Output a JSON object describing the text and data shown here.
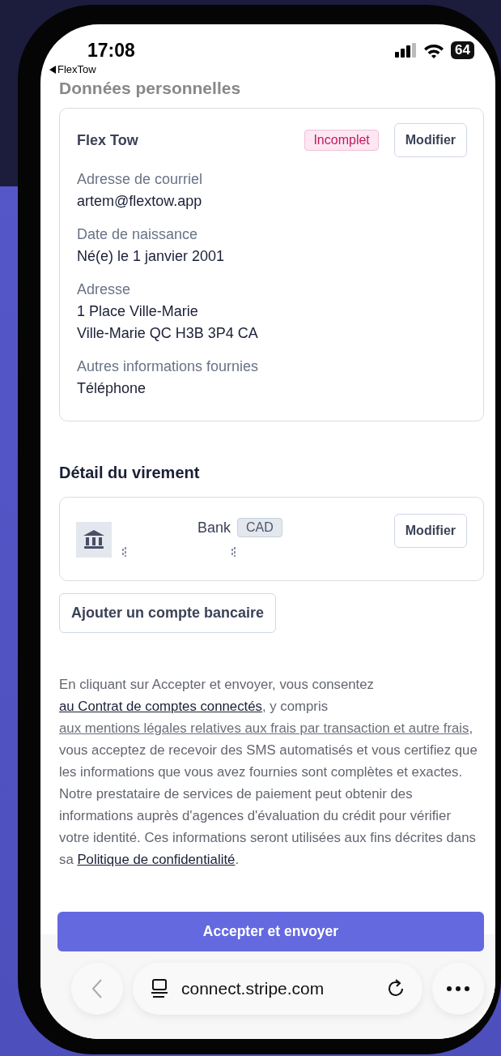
{
  "status_bar": {
    "time": "17:08",
    "battery": "64"
  },
  "back_link": {
    "label": "FlexTow"
  },
  "section_title": "Données personnelles",
  "profile": {
    "name": "Flex Tow",
    "badge": "Incomplet",
    "edit_button": "Modifier",
    "fields": [
      {
        "label": "Adresse de courriel",
        "lines": [
          "artem@flextow.app"
        ]
      },
      {
        "label": "Date de naissance",
        "lines": [
          "Né(e) le 1 janvier 2001"
        ]
      },
      {
        "label": "Adresse",
        "lines": [
          "1 Place Ville-Marie",
          "Ville-Marie QC H3B 3P4 CA"
        ]
      },
      {
        "label": "Autres informations fournies",
        "lines": [
          "Téléphone"
        ]
      }
    ]
  },
  "payout": {
    "title": "Détail du virement",
    "bank_name": "Bank",
    "currency": "CAD",
    "edit_button": "Modifier",
    "add_button": "Ajouter un compte bancaire"
  },
  "consent": {
    "segments": [
      {
        "kind": "text",
        "text": "En cliquant sur Accepter et envoyer, vous consentez "
      },
      {
        "kind": "link",
        "text": "au Contrat de comptes connectés"
      },
      {
        "kind": "text",
        "text": ", y compris "
      },
      {
        "kind": "muted-link",
        "text": "aux mentions légales relatives aux frais par transaction et autre frais"
      },
      {
        "kind": "text",
        "text": ", vous acceptez de recevoir des SMS automatisés et vous certifiez que les informations que vous avez fournies sont complètes et exactes. Notre prestataire de services de paiement peut obtenir des informations auprès d'agences d'évaluation du crédit pour vérifier votre identité. Ces informations seront utilisées aux fins décrites dans sa "
      },
      {
        "kind": "link",
        "text": "Politique de confidentialité"
      },
      {
        "kind": "text",
        "text": "."
      }
    ]
  },
  "accept_button": "Accepter et envoyer",
  "browser": {
    "url": "connect.stripe.com"
  }
}
